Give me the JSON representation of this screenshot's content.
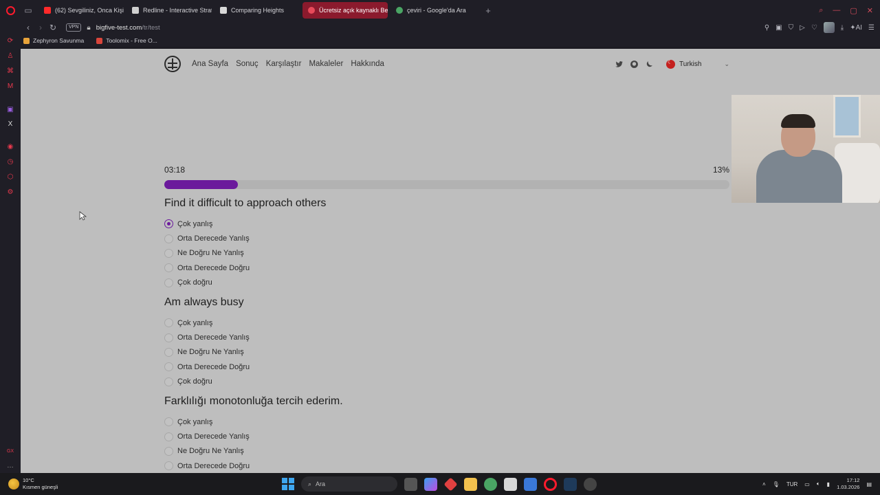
{
  "browser": {
    "tabs": [
      {
        "label": "(62) Sevgiliniz, Onca Kişi /",
        "color": "#ff2a2a"
      },
      {
        "label": "Redline - Interactive Strat",
        "color": "#d0d0d0"
      },
      {
        "label": "Comparing Heights",
        "color": "#d8d8d8"
      },
      {
        "label": "Ücretsiz açık kaynaklı Beş",
        "color": "#e84a5a",
        "active": true
      },
      {
        "label": "çeviri - Google'da Ara",
        "color": "#4aa564"
      }
    ],
    "address": {
      "vpn": "VPN",
      "domain": "bigfive-test.com",
      "path": "/tr/test"
    },
    "bookmarks": [
      {
        "label": "Zephyron Savunma",
        "color": "#e8a33a"
      },
      {
        "label": "Toolomix - Free O...",
        "color": "#d9453b"
      }
    ]
  },
  "site": {
    "nav": [
      "Ana Sayfa",
      "Sonuç",
      "Karşılaştır",
      "Makaleler",
      "Hakkında"
    ],
    "language": "Turkish",
    "accent": "#6b1a9c"
  },
  "test": {
    "timer": "03:18",
    "progress_label": "13%",
    "progress_value": 0.13,
    "questions": [
      {
        "title": "Find it difficult to approach others",
        "options": [
          "Çok yanlış",
          "Orta Derecede Yanlış",
          "Ne Doğru Ne Yanlış",
          "Orta Derecede Doğru",
          "Çok doğru"
        ],
        "selected": 0
      },
      {
        "title": "Am always busy",
        "options": [
          "Çok yanlış",
          "Orta Derecede Yanlış",
          "Ne Doğru Ne Yanlış",
          "Orta Derecede Doğru",
          "Çok doğru"
        ],
        "selected": null
      },
      {
        "title": "Farklılığı monotonluğa tercih ederim.",
        "options": [
          "Çok yanlış",
          "Orta Derecede Yanlış",
          "Ne Doğru Ne Yanlış",
          "Orta Derecede Doğru"
        ],
        "selected": null
      }
    ]
  },
  "taskbar": {
    "temperature": "10°C",
    "weather": "Kısmen güneşli",
    "search_placeholder": "Ara",
    "language": "TUR",
    "time": "17:12",
    "date": "1.03.2026"
  }
}
